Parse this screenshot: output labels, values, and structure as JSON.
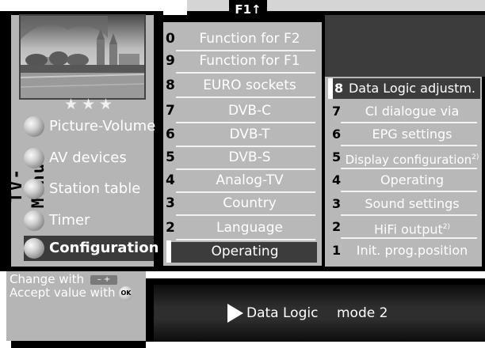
{
  "header": {
    "badge_label": "F1",
    "badge_arrow": "↑"
  },
  "sidebar": {
    "vertical_title": "TV-Menu",
    "stars": "★★★",
    "items": [
      {
        "label": "Picture-Volume"
      },
      {
        "label": "AV devices"
      },
      {
        "label": "Station table"
      },
      {
        "label": "Timer"
      },
      {
        "label": "Configuration",
        "selected": true
      }
    ]
  },
  "middle_list": {
    "items": [
      {
        "num": "0",
        "label": "Function for F2"
      },
      {
        "num": "9",
        "label": "Function for F1"
      },
      {
        "num": "8",
        "label": "EURO sockets"
      },
      {
        "num": "7",
        "label": "DVB-C"
      },
      {
        "num": "6",
        "label": "DVB-T"
      },
      {
        "num": "5",
        "label": "DVB-S"
      },
      {
        "num": "4",
        "label": "Analog-TV"
      },
      {
        "num": "3",
        "label": "Country"
      },
      {
        "num": "2",
        "label": "Language"
      },
      {
        "num": "1",
        "label": "Operating",
        "selected": true
      }
    ]
  },
  "right_list": {
    "items": [
      {
        "num": "8",
        "label": "Data Logic adjustm.",
        "selected": true
      },
      {
        "num": "7",
        "label": "CI dialogue via"
      },
      {
        "num": "6",
        "label": "EPG settings"
      },
      {
        "num": "5",
        "label": "Display configuration",
        "footnote": "2)"
      },
      {
        "num": "4",
        "label": "Operating"
      },
      {
        "num": "3",
        "label": "Sound settings"
      },
      {
        "num": "2",
        "label": "HiFi output",
        "footnote": "2)"
      },
      {
        "num": "1",
        "label": "Init. prog.position"
      }
    ]
  },
  "hints": {
    "change_with": "Change with",
    "change_keys": "–  +",
    "accept_with": "Accept value with",
    "ok_label": "OK"
  },
  "status_bar": {
    "label": "Data Logic",
    "value": "mode 2"
  },
  "colors": {
    "panel_gray": "#b8b8b8",
    "dark_gray": "#3c3c3c",
    "text_white": "#ffffff",
    "frame_black": "#000000"
  },
  "icons": {
    "play": "play-triangle-icon",
    "ok": "ok-button-icon",
    "menu_ball": "menu-ball-icon"
  }
}
